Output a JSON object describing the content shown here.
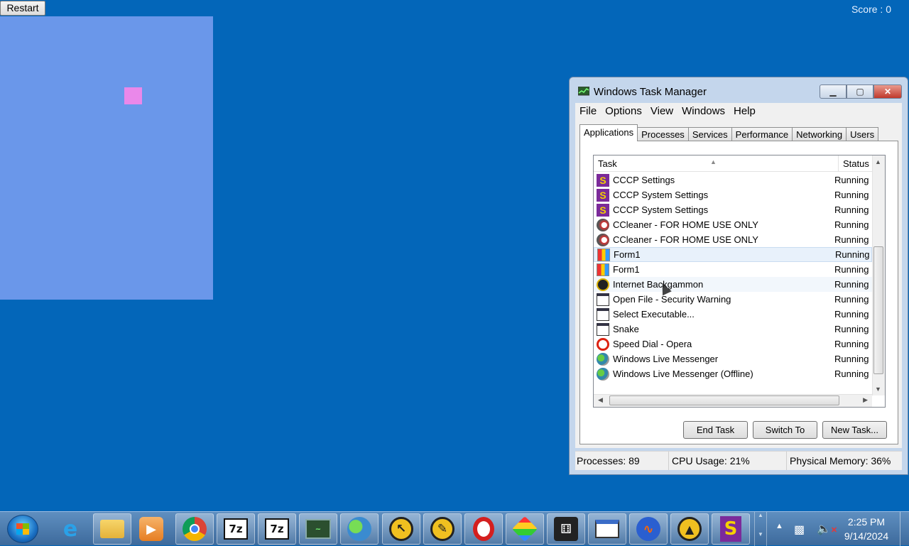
{
  "game": {
    "restart_label": "Restart",
    "score_text": "Score : 0",
    "colors": {
      "board": "#6a97ea",
      "food": "#ea88ea",
      "desktop": "#0366b9"
    }
  },
  "task_manager": {
    "title": "Windows Task Manager",
    "menu": [
      "File",
      "Options",
      "View",
      "Windows",
      "Help"
    ],
    "tabs": [
      "Applications",
      "Processes",
      "Services",
      "Performance",
      "Networking",
      "Users"
    ],
    "active_tab": "Applications",
    "columns": {
      "task": "Task",
      "status": "Status"
    },
    "rows": [
      {
        "name": "CCCP Settings",
        "status": "Running",
        "icon": "cccp-icon"
      },
      {
        "name": "CCCP System Settings",
        "status": "Running",
        "icon": "cccp-icon"
      },
      {
        "name": "CCCP System Settings",
        "status": "Running",
        "icon": "cccp-icon"
      },
      {
        "name": "CCleaner - FOR HOME USE ONLY",
        "status": "Running",
        "icon": "ccleaner-icon"
      },
      {
        "name": "CCleaner - FOR HOME USE ONLY",
        "status": "Running",
        "icon": "ccleaner-icon"
      },
      {
        "name": "Form1",
        "status": "Running",
        "icon": "form-icon"
      },
      {
        "name": "Form1",
        "status": "Running",
        "icon": "form-icon"
      },
      {
        "name": "Internet Backgammon",
        "status": "Running",
        "icon": "backgammon-icon"
      },
      {
        "name": "Open File - Security Warning",
        "status": "Running",
        "icon": "window-icon"
      },
      {
        "name": "Select Executable...",
        "status": "Running",
        "icon": "window-icon"
      },
      {
        "name": "Snake",
        "status": "Running",
        "icon": "window-icon"
      },
      {
        "name": "Speed Dial - Opera",
        "status": "Running",
        "icon": "opera-icon"
      },
      {
        "name": "Windows Live Messenger",
        "status": "Running",
        "icon": "messenger-icon"
      },
      {
        "name": "Windows Live Messenger (Offline)",
        "status": "Running",
        "icon": "messenger-icon"
      }
    ],
    "buttons": {
      "end_task": "End Task",
      "switch_to": "Switch To",
      "new_task": "New Task..."
    },
    "status_bar": {
      "processes": "Processes: 89",
      "cpu": "CPU Usage: 21%",
      "memory": "Physical Memory: 36%"
    }
  },
  "taskbar": {
    "items": [
      "internet-explorer-icon",
      "file-explorer-icon",
      "media-player-icon",
      "chrome-icon",
      "7zip-icon",
      "7zip-icon",
      "task-manager-icon",
      "messenger-icon",
      "pointer-tool-icon",
      "pencil-tool-icon",
      "opera-icon",
      "bluestacks-icon",
      "dice-game-icon",
      "blank-window-icon",
      "audacity-icon",
      "triangle-app-icon",
      "cccp-icon"
    ],
    "clock": {
      "time": "2:25 PM",
      "date": "9/14/2024"
    }
  }
}
